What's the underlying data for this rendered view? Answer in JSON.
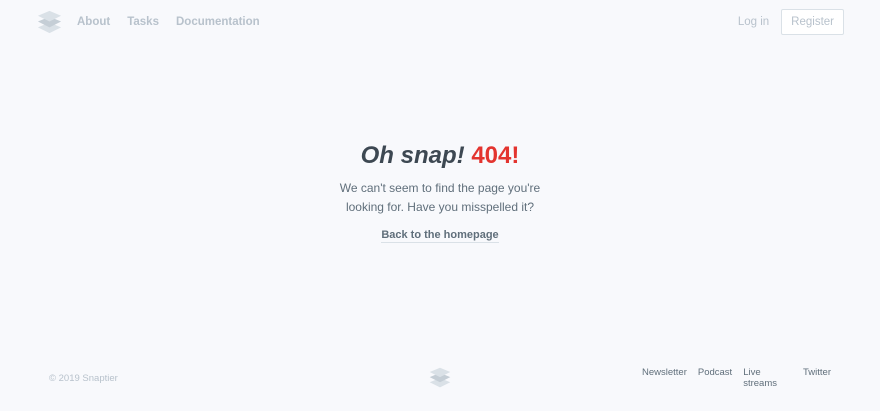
{
  "header": {
    "nav": [
      {
        "label": "About"
      },
      {
        "label": "Tasks"
      },
      {
        "label": "Documentation"
      }
    ],
    "login_label": "Log in",
    "register_label": "Register"
  },
  "main": {
    "headline_text": "Oh snap!",
    "headline_code": "404!",
    "message": "We can't seem to find the page you're looking for. Have you misspelled it?",
    "home_link": "Back to the homepage"
  },
  "footer": {
    "copyright": "© 2019 Snaptier",
    "links": [
      {
        "label": "Newsletter"
      },
      {
        "label": "Podcast"
      },
      {
        "label": "Live streams"
      },
      {
        "label": "Twitter"
      }
    ]
  },
  "colors": {
    "background": "#f8f9fc",
    "accent_error": "#e3342f",
    "text_dark": "#3d4852",
    "text_muted": "#b8c2cc"
  },
  "icons": {
    "logo": "stacked-layers-icon"
  }
}
